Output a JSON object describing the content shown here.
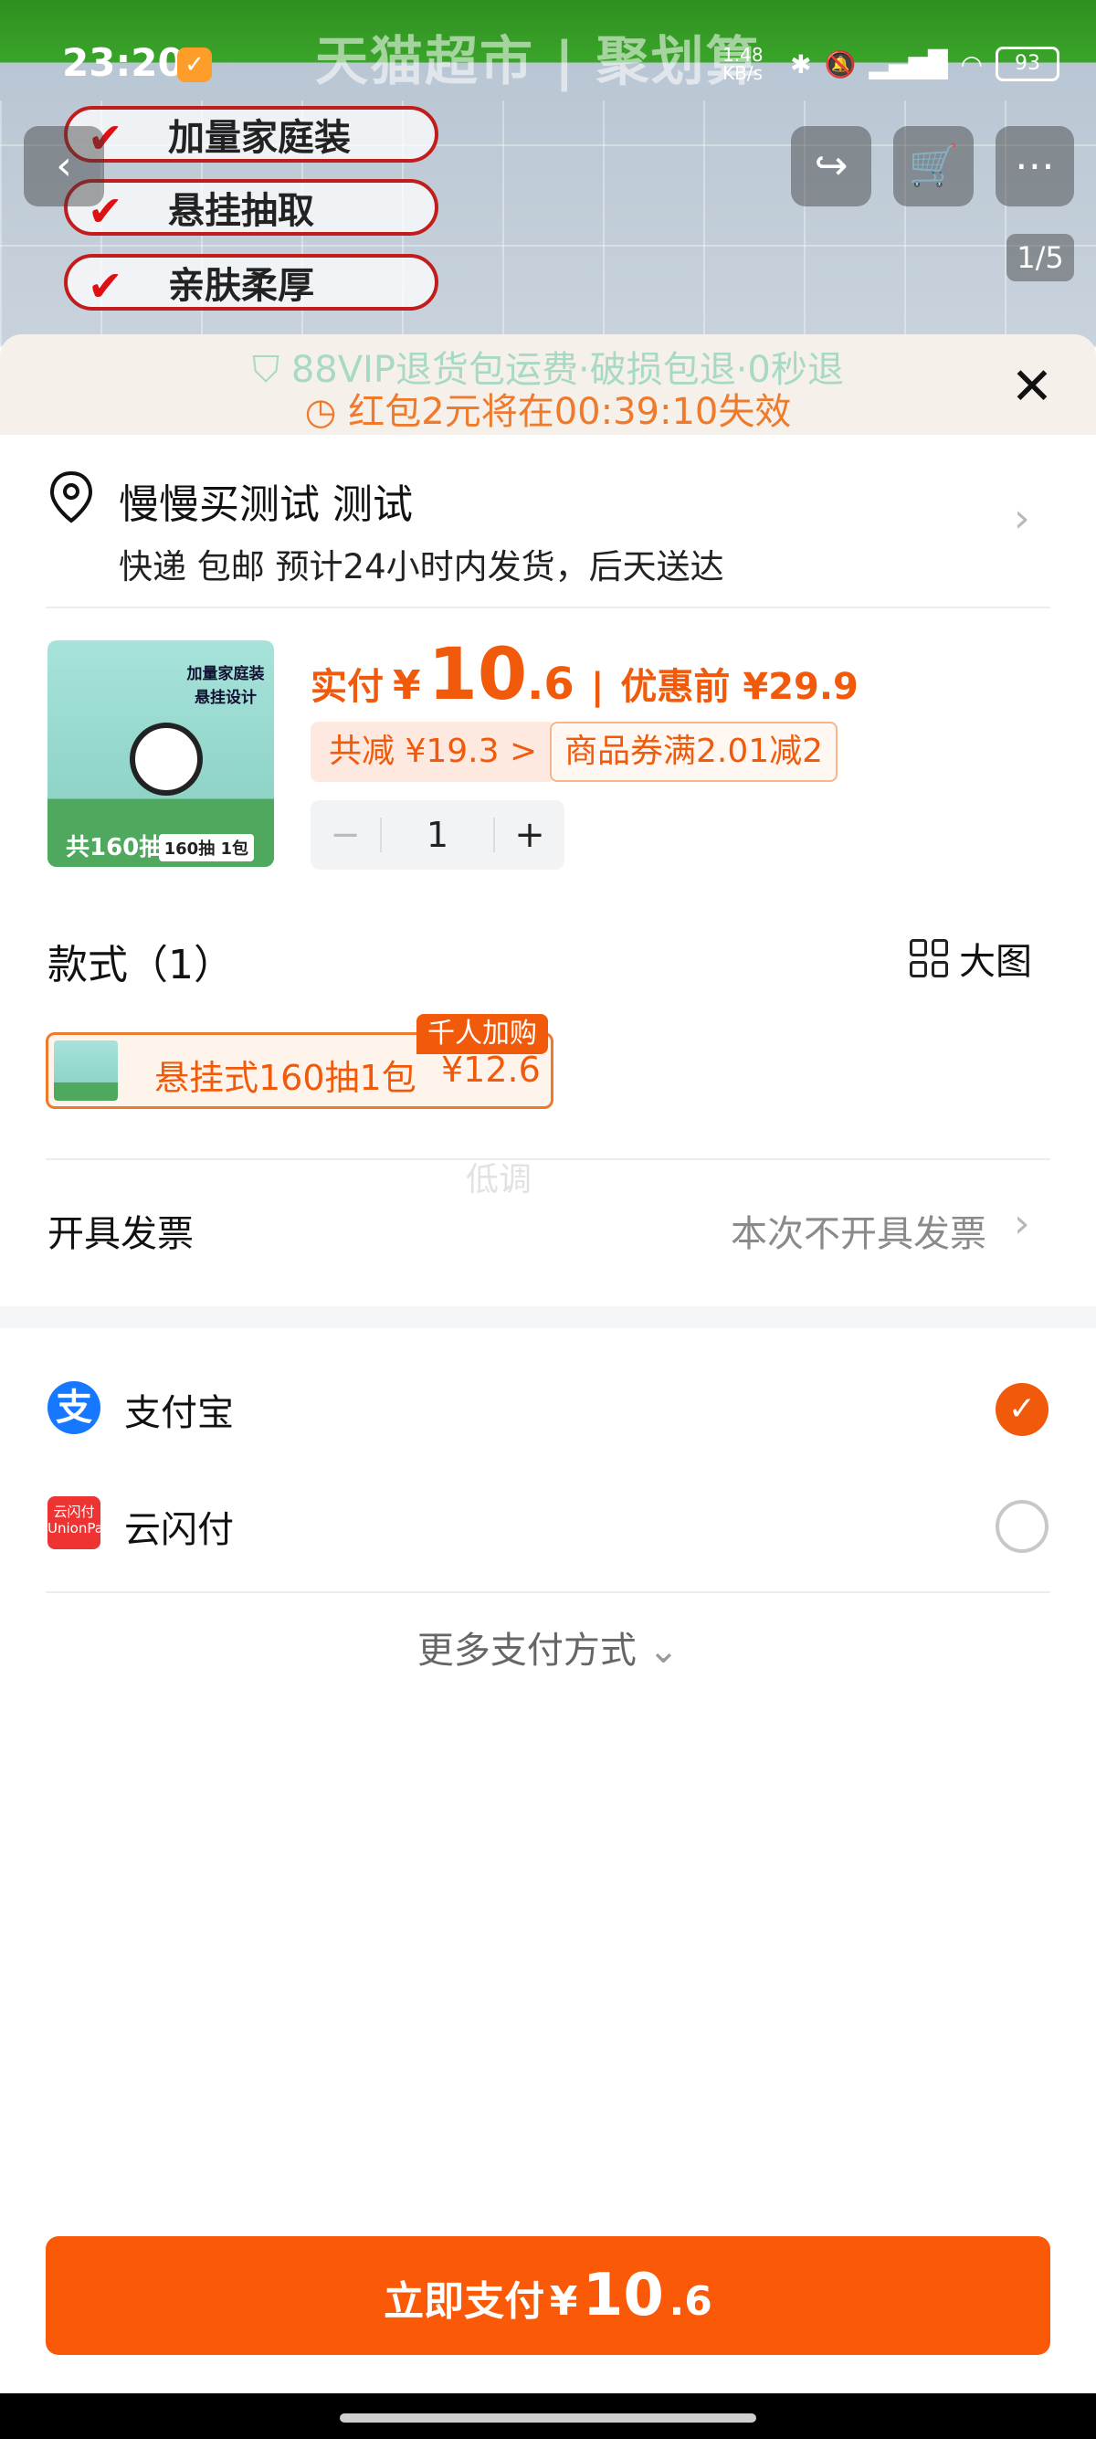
{
  "status_bar": {
    "time": "23:20",
    "app_icon": "taobao-like-icon",
    "net_speed": "1.48 KB/s",
    "battery": "93"
  },
  "background_page": {
    "shop_title": "天猫超市 | 聚划算",
    "promo_items": [
      "加量家庭装",
      "悬挂抽取",
      "亲肤柔厚"
    ],
    "page_indicator": "1/5",
    "back_icon": "back-icon",
    "share_icon": "share-icon",
    "cart_icon": "cart-icon",
    "more_icon": "more-icon"
  },
  "banner": {
    "line1": "88VIP退货包运费·破损包退·0秒退",
    "line2": "红包2元将在00:39:10失效",
    "line1_color": "#a7d9c4",
    "line2_color": "#f07a2c"
  },
  "address": {
    "name": "慢慢买测试 测试",
    "shipping": "快递 包邮 预计24小时内发货，后天送达"
  },
  "product": {
    "image_text_top": "加量家庭装 悬挂设计",
    "image_text_bottom": "共160抽",
    "image_badge": "160抽 1包",
    "pay_label": "实付",
    "currency": "¥",
    "price_int": "10",
    "price_dec": ".6",
    "separator": "|",
    "pre_discount": "优惠前 ¥29.9",
    "discount_tag": "共减 ¥19.3 >",
    "coupon_tag": "商品券满2.01减2",
    "quantity": "1",
    "minus": "−",
    "plus": "+"
  },
  "style_section": {
    "title": "款式（1）",
    "big_image_label": "大图",
    "hot_badge": "千人加购",
    "variant_label": "悬挂式160抽1包",
    "variant_price": "¥12.6"
  },
  "watermark": "低调",
  "invoice": {
    "label": "开具发票",
    "value": "本次不开具发票"
  },
  "payment": {
    "methods": [
      {
        "name": "支付宝",
        "selected": true,
        "icon": "alipay-icon"
      },
      {
        "name": "云闪付",
        "selected": false,
        "icon": "unionpay-icon"
      }
    ],
    "more": "更多支付方式"
  },
  "pay_button": {
    "label": "立即支付",
    "currency": "¥",
    "amount_int": "10",
    "amount_dec": ".6"
  },
  "colors": {
    "accent": "#f05a0a",
    "pay_button": "#fa5a08",
    "alipay": "#1677ff"
  }
}
